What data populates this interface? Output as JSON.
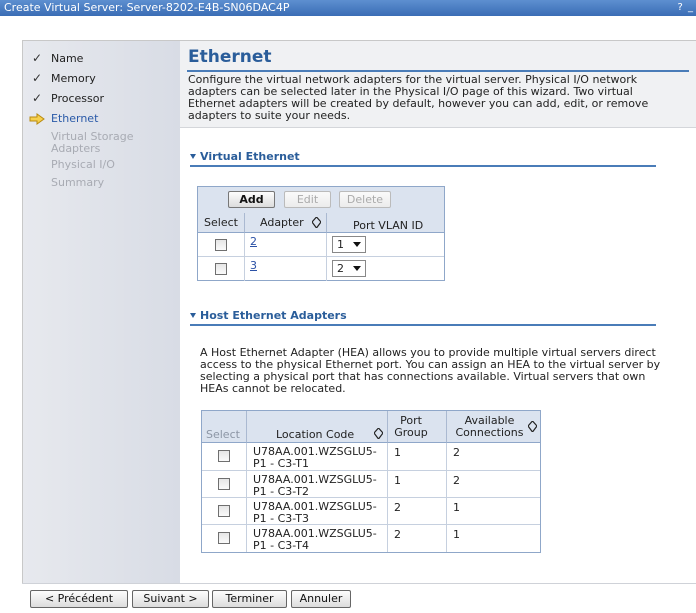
{
  "window": {
    "title": "Create Virtual Server: Server-8202-E4B-SN06DAC4P",
    "controls": "? _"
  },
  "nav": {
    "items": [
      {
        "label": "Name",
        "state": "done"
      },
      {
        "label": "Memory",
        "state": "done"
      },
      {
        "label": "Processor",
        "state": "done"
      },
      {
        "label": "Ethernet",
        "state": "current"
      },
      {
        "label": "Virtual Storage Adapters",
        "state": "disabled"
      },
      {
        "label": "Physical I/O",
        "state": "disabled"
      },
      {
        "label": "Summary",
        "state": "disabled"
      }
    ],
    "check_glyph": "✓"
  },
  "page": {
    "title": "Ethernet",
    "description": "Configure the virtual network adapters for the virtual server. Physical I/O network adapters can be selected later in the Physical I/O page of this wizard. Two virtual Ethernet adapters will be created by default, however you can add, edit, or remove adapters to suite your needs."
  },
  "virtual_ethernet": {
    "title": "Virtual Ethernet",
    "buttons": {
      "add": "Add",
      "edit": "Edit",
      "delete": "Delete"
    },
    "columns": {
      "select": "Select",
      "adapter": "Adapter",
      "vlan": "Port VLAN ID"
    },
    "rows": [
      {
        "adapter": "2",
        "vlan": "1"
      },
      {
        "adapter": "3",
        "vlan": "2"
      }
    ]
  },
  "hea": {
    "title": "Host Ethernet Adapters",
    "description": "A Host Ethernet Adapter (HEA) allows you to provide multiple virtual servers direct access to the physical Ethernet port. You can assign an HEA to the virtual server by selecting a physical port that has connections available. Virtual servers that own HEAs cannot be relocated.",
    "columns": {
      "select": "Select",
      "location": "Location Code",
      "port_group": "Port Group",
      "available": "Available Connections"
    },
    "rows": [
      {
        "location_line1": "U78AA.001.WZSGLU5-",
        "location_line2": "P1 - C3-T1",
        "port_group": "1",
        "available": "2"
      },
      {
        "location_line1": "U78AA.001.WZSGLU5-",
        "location_line2": "P1 - C3-T2",
        "port_group": "1",
        "available": "2"
      },
      {
        "location_line1": "U78AA.001.WZSGLU5-",
        "location_line2": "P1 - C3-T3",
        "port_group": "2",
        "available": "1"
      },
      {
        "location_line1": "U78AA.001.WZSGLU5-",
        "location_line2": "P1 - C3-T4",
        "port_group": "2",
        "available": "1"
      }
    ]
  },
  "footer": {
    "previous": "< Précédent",
    "next": "Suivant >",
    "finish": "Terminer",
    "cancel": "Annuler"
  }
}
